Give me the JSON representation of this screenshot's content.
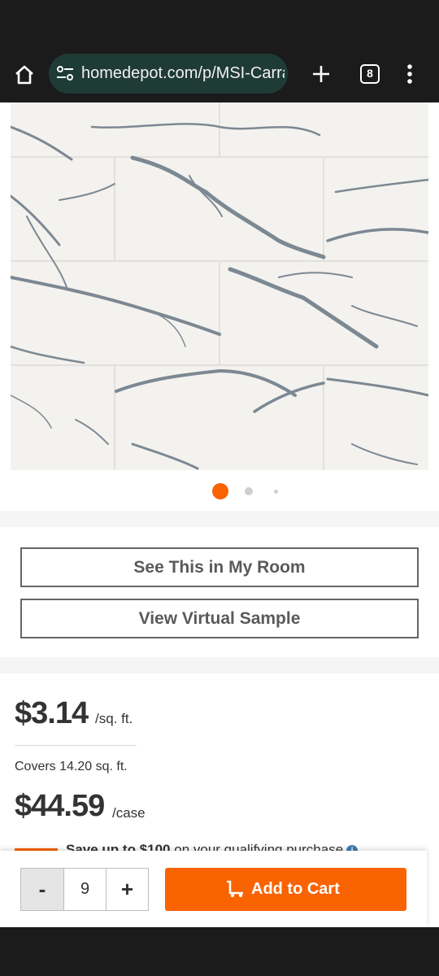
{
  "browser": {
    "url": "homedepot.com/p/MSI-Carrara",
    "tab_count": "8"
  },
  "gallery": {
    "active_index": 1,
    "dot_count": 3
  },
  "actions": {
    "see_in_room": "See This in My Room",
    "virtual_sample": "View Virtual Sample"
  },
  "pricing": {
    "price_per_unit": "$3.14",
    "unit": "/sq. ft.",
    "coverage": "Covers 14.20 sq. ft.",
    "case_price": "$44.59",
    "case_unit": "/case",
    "promo_bold": "Save up to $100",
    "promo_rest": " on your qualifying purchase"
  },
  "cart": {
    "minus_label": "-",
    "quantity": "9",
    "plus_label": "+",
    "add_to_cart": "Add to Cart"
  },
  "colors": {
    "accent": "#f96302",
    "url_pill": "#1f3b35"
  },
  "icons": [
    "home-icon",
    "tune-icon",
    "plus-icon",
    "tabs-icon",
    "more-vert-icon",
    "info-icon",
    "cart-icon"
  ]
}
